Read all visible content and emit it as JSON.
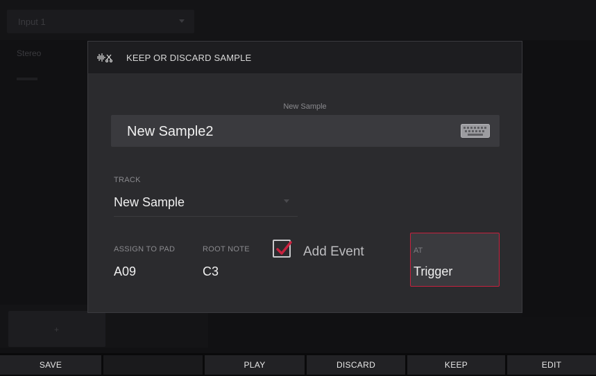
{
  "background": {
    "input_select": "Input 1",
    "stereo_label": "Stereo"
  },
  "dialog": {
    "title": "KEEP OR DISCARD SAMPLE",
    "header_icon": "waveform-scissors-icon",
    "name_label": "New Sample",
    "name_value": "New Sample2",
    "keyboard_icon": "keyboard-icon",
    "track_label": "TRACK",
    "track_value": "New Sample",
    "assign_label": "ASSIGN TO PAD",
    "assign_value": "A09",
    "root_label": "ROOT NOTE",
    "root_value": "C3",
    "add_event_label": "Add Event",
    "add_event_checked": true,
    "at_label": "AT",
    "at_value": "Trigger"
  },
  "bottom_bar": {
    "save": "SAVE",
    "play": "PLAY",
    "discard": "DISCARD",
    "keep": "KEEP",
    "edit": "EDIT"
  },
  "colors": {
    "accent": "#c8213e",
    "dialog_bg": "#2b2b2e",
    "field_bg": "#3a3a3e"
  }
}
